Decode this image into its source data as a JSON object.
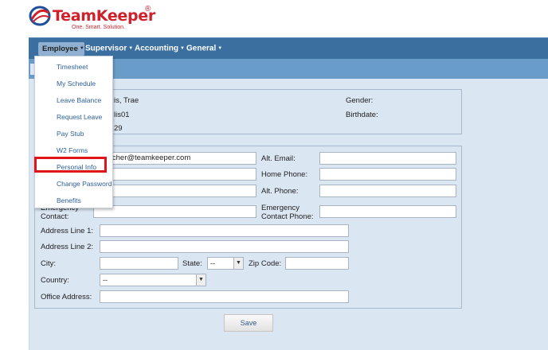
{
  "brand": {
    "name_part1": "Team",
    "name_part2": "Keeper",
    "registered": "®",
    "tagline": "One. Smart. Solution."
  },
  "nav": {
    "items": [
      {
        "label": "Employee"
      },
      {
        "label": "Supervisor"
      },
      {
        "label": "Accounting"
      },
      {
        "label": "General"
      }
    ],
    "caret": "▼"
  },
  "employee_menu": {
    "items": [
      {
        "label": "Timesheet"
      },
      {
        "label": "My Schedule"
      },
      {
        "label": "Leave Balance"
      },
      {
        "label": "Request Leave"
      },
      {
        "label": "Pay Stub"
      },
      {
        "label": "W2 Forms"
      },
      {
        "label": "Personal Info",
        "highlighted": true
      },
      {
        "label": "Change Password"
      },
      {
        "label": "Benefits"
      }
    ]
  },
  "info": {
    "name_partial": "is, Trae",
    "username_partial": "lis01",
    "number_partial": "29",
    "gender_label": "Gender:",
    "birthdate_label": "Birthdate:"
  },
  "form": {
    "email_value": "y.hatcher@teamkeeper.com",
    "alt_email_label": "Alt. Email:",
    "home_phone_label": "Home Phone:",
    "alt_phone_label": "Alt. Phone:",
    "emergency_contact_label_1": "Emergency",
    "emergency_contact_label_2": "Contact:",
    "emergency_phone_label_1": "Emergency",
    "emergency_phone_label_2": "Contact Phone:",
    "address1_label": "Address Line 1:",
    "address2_label": "Address Line 2:",
    "city_label": "City:",
    "state_label": "State:",
    "state_value": "--",
    "zip_label": "Zip Code:",
    "country_label": "Country:",
    "country_value": "--",
    "office_address_label": "Office Address:",
    "save_label": "Save"
  },
  "colors": {
    "brand_red": "#d0202a",
    "nav_blue": "#3b6fa0",
    "panel_bg": "#dbe6f3",
    "link_blue": "#2d5f99",
    "highlight_red": "#e0141b"
  }
}
